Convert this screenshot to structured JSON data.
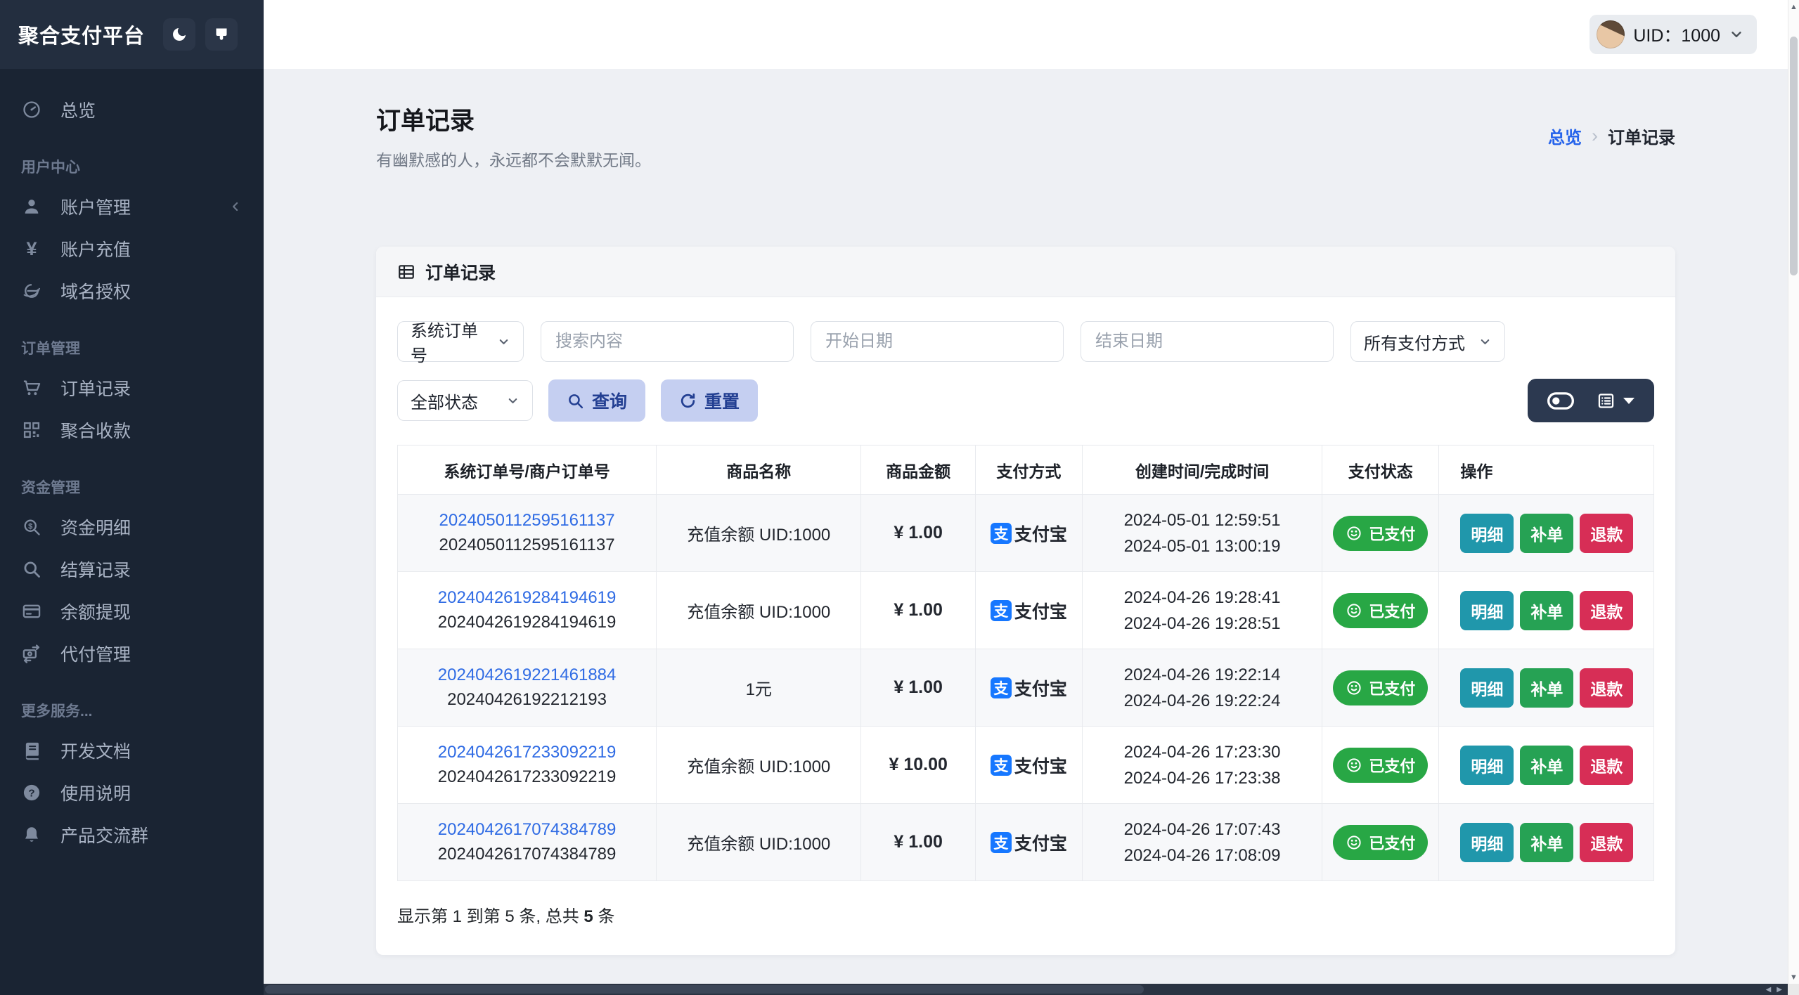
{
  "app": {
    "title": "聚合支付平台"
  },
  "topbar": {
    "uid_label": "UID：1000"
  },
  "theme": {
    "sidebar_bg": "#1a2433",
    "accent_blue": "#2563eb",
    "link_blue": "#2f6be4",
    "success_green": "#28a745",
    "info_teal": "#2097ab",
    "danger_red": "#d72e56",
    "alipay_blue": "#1677ff",
    "soft_button_bg": "#c5cff1",
    "soft_button_text": "#233f92"
  },
  "sidebar": {
    "sections": [
      {
        "label": "",
        "items": [
          {
            "label": "总览",
            "icon": "dashboard"
          }
        ]
      },
      {
        "label": "用户中心",
        "items": [
          {
            "label": "账户管理",
            "icon": "person",
            "has_submenu": true
          },
          {
            "label": "账户充值",
            "icon": "yen"
          },
          {
            "label": "域名授权",
            "icon": "globe"
          }
        ]
      },
      {
        "label": "订单管理",
        "items": [
          {
            "label": "订单记录",
            "icon": "cart"
          },
          {
            "label": "聚合收款",
            "icon": "qrcode"
          }
        ]
      },
      {
        "label": "资金管理",
        "items": [
          {
            "label": "资金明细",
            "icon": "search-dollar"
          },
          {
            "label": "结算记录",
            "icon": "search"
          },
          {
            "label": "余额提现",
            "icon": "card"
          },
          {
            "label": "代付管理",
            "icon": "transfer"
          }
        ]
      },
      {
        "label": "更多服务...",
        "items": [
          {
            "label": "开发文档",
            "icon": "book"
          },
          {
            "label": "使用说明",
            "icon": "question"
          },
          {
            "label": "产品交流群",
            "icon": "bell"
          }
        ]
      }
    ]
  },
  "page": {
    "title": "订单记录",
    "subtitle": "有幽默感的人，永远都不会默默无闻。",
    "breadcrumb": [
      "总览",
      "订单记录"
    ],
    "breadcrumb_separator": "›"
  },
  "card": {
    "header": "订单记录"
  },
  "filters": {
    "order_type": "系统订单号",
    "search_placeholder": "搜索内容",
    "start_date_placeholder": "开始日期",
    "end_date_placeholder": "结束日期",
    "pay_method": "所有支付方式",
    "status": "全部状态",
    "query_label": "查询",
    "reset_label": "重置"
  },
  "table": {
    "headers": [
      "系统订单号/商户订单号",
      "商品名称",
      "商品金额",
      "支付方式",
      "创建时间/完成时间",
      "支付状态",
      "操作"
    ],
    "row_actions": [
      {
        "label": "明细",
        "kind": "detail"
      },
      {
        "label": "补单",
        "kind": "supplement"
      },
      {
        "label": "退款",
        "kind": "refund"
      }
    ],
    "rows": [
      {
        "sys": "2024050112595161137",
        "merchant": "2024050112595161137",
        "product": "充值余额 UID:1000",
        "currency": "¥",
        "amount": "1.00",
        "method": "支付宝",
        "created": "2024-05-01 12:59:51",
        "completed": "2024-05-01 13:00:19",
        "status": "已支付"
      },
      {
        "sys": "2024042619284194619",
        "merchant": "2024042619284194619",
        "product": "充值余额 UID:1000",
        "currency": "¥",
        "amount": "1.00",
        "method": "支付宝",
        "created": "2024-04-26 19:28:41",
        "completed": "2024-04-26 19:28:51",
        "status": "已支付"
      },
      {
        "sys": "2024042619221461884",
        "merchant": "20240426192212193",
        "product": "1元",
        "currency": "¥",
        "amount": "1.00",
        "method": "支付宝",
        "created": "2024-04-26 19:22:14",
        "completed": "2024-04-26 19:22:24",
        "status": "已支付"
      },
      {
        "sys": "2024042617233092219",
        "merchant": "2024042617233092219",
        "product": "充值余额 UID:1000",
        "currency": "¥",
        "amount": "10.00",
        "method": "支付宝",
        "created": "2024-04-26 17:23:30",
        "completed": "2024-04-26 17:23:38",
        "status": "已支付"
      },
      {
        "sys": "2024042617074384789",
        "merchant": "2024042617074384789",
        "product": "充值余额 UID:1000",
        "currency": "¥",
        "amount": "1.00",
        "method": "支付宝",
        "created": "2024-04-26 17:07:43",
        "completed": "2024-04-26 17:08:09",
        "status": "已支付"
      }
    ],
    "footer_prefix": "显示第 1 到第 5 条, 总共 ",
    "footer_count": "5",
    "footer_suffix": " 条"
  }
}
